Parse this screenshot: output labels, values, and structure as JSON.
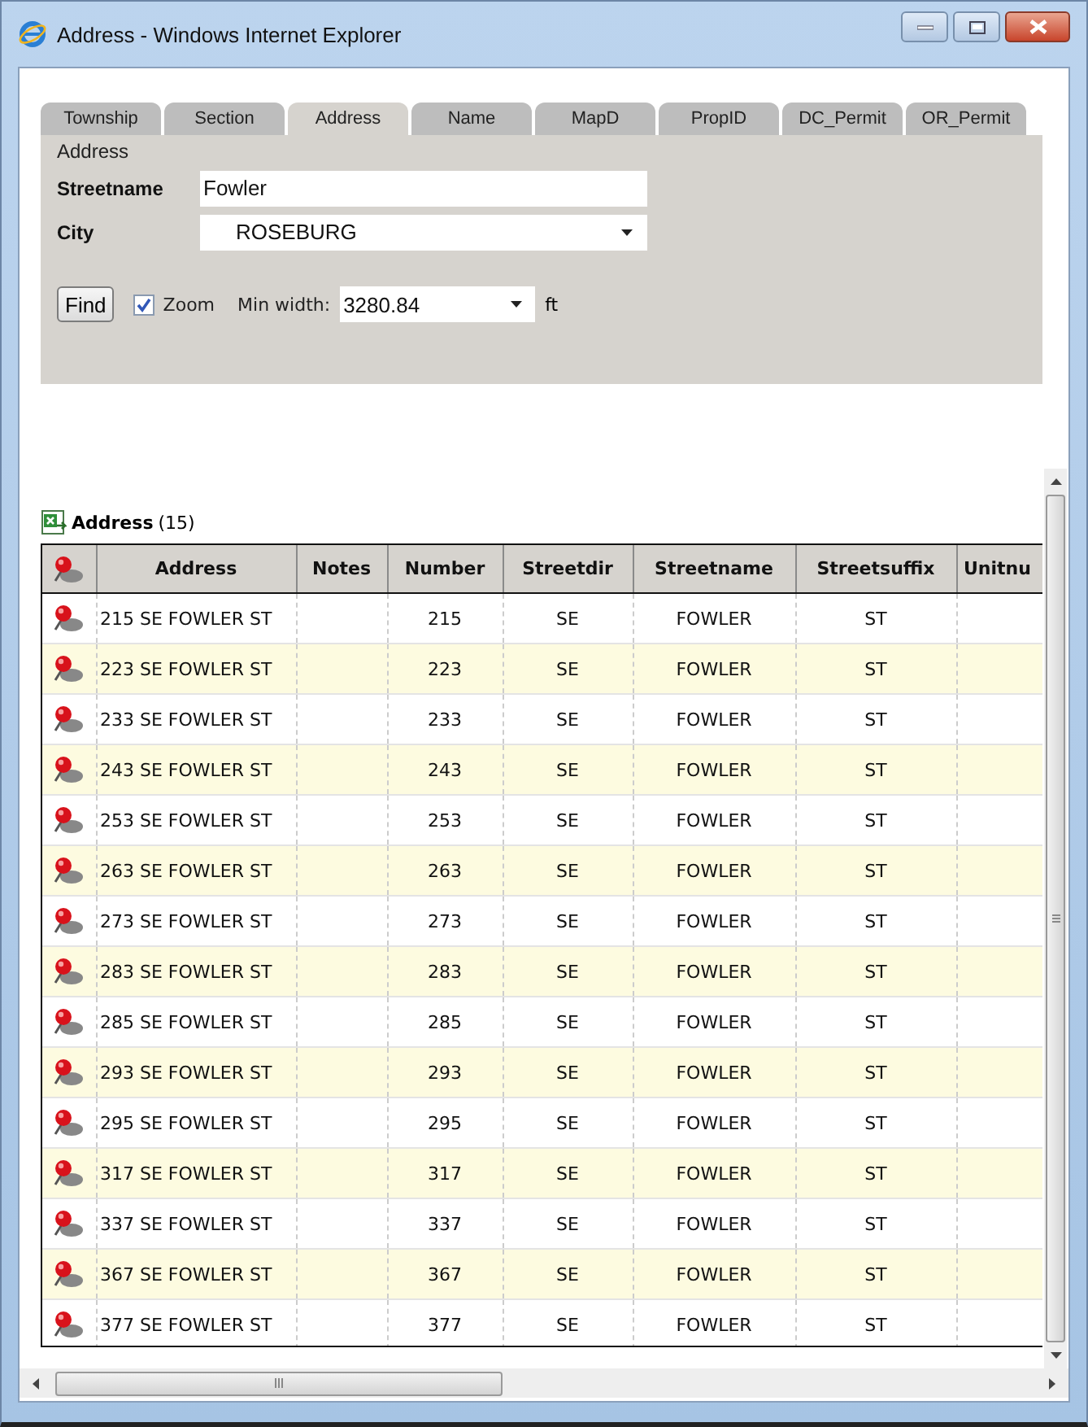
{
  "window": {
    "title": "Address - Windows Internet Explorer"
  },
  "tabs": [
    {
      "label": "Township",
      "selected": false
    },
    {
      "label": "Section",
      "selected": false
    },
    {
      "label": "Address",
      "selected": true
    },
    {
      "label": "Name",
      "selected": false
    },
    {
      "label": "MapD",
      "selected": false
    },
    {
      "label": "PropID",
      "selected": false
    },
    {
      "label": "DC_Permit",
      "selected": false
    },
    {
      "label": "OR_Permit",
      "selected": false
    }
  ],
  "panel": {
    "heading": "Address",
    "fields": [
      {
        "label": "Streetname",
        "kind": "text",
        "value": "Fowler"
      },
      {
        "label": "City",
        "kind": "select",
        "value": "ROSEBURG"
      }
    ],
    "find_button": "Find",
    "zoom": {
      "label": "Zoom",
      "checked": true
    },
    "min_width": {
      "label": "Min width:",
      "value": "3280.84",
      "unit": "ft"
    }
  },
  "results": {
    "title": "Address",
    "count": "(15)",
    "columns": [
      "Address",
      "Notes",
      "Number",
      "Streetdir",
      "Streetname",
      "Streetsuffix",
      "Unitnu"
    ],
    "rows": [
      {
        "address": "215 SE FOWLER ST",
        "number": "215",
        "streetdir": "SE",
        "streetname": "FOWLER",
        "streetsuffix": "ST"
      },
      {
        "address": "223 SE FOWLER ST",
        "number": "223",
        "streetdir": "SE",
        "streetname": "FOWLER",
        "streetsuffix": "ST"
      },
      {
        "address": "233 SE FOWLER ST",
        "number": "233",
        "streetdir": "SE",
        "streetname": "FOWLER",
        "streetsuffix": "ST"
      },
      {
        "address": "243 SE FOWLER ST",
        "number": "243",
        "streetdir": "SE",
        "streetname": "FOWLER",
        "streetsuffix": "ST"
      },
      {
        "address": "253 SE FOWLER ST",
        "number": "253",
        "streetdir": "SE",
        "streetname": "FOWLER",
        "streetsuffix": "ST"
      },
      {
        "address": "263 SE FOWLER ST",
        "number": "263",
        "streetdir": "SE",
        "streetname": "FOWLER",
        "streetsuffix": "ST"
      },
      {
        "address": "273 SE FOWLER ST",
        "number": "273",
        "streetdir": "SE",
        "streetname": "FOWLER",
        "streetsuffix": "ST"
      },
      {
        "address": "283 SE FOWLER ST",
        "number": "283",
        "streetdir": "SE",
        "streetname": "FOWLER",
        "streetsuffix": "ST"
      },
      {
        "address": "285 SE FOWLER ST",
        "number": "285",
        "streetdir": "SE",
        "streetname": "FOWLER",
        "streetsuffix": "ST"
      },
      {
        "address": "293 SE FOWLER ST",
        "number": "293",
        "streetdir": "SE",
        "streetname": "FOWLER",
        "streetsuffix": "ST"
      },
      {
        "address": "295 SE FOWLER ST",
        "number": "295",
        "streetdir": "SE",
        "streetname": "FOWLER",
        "streetsuffix": "ST"
      },
      {
        "address": "317 SE FOWLER ST",
        "number": "317",
        "streetdir": "SE",
        "streetname": "FOWLER",
        "streetsuffix": "ST"
      },
      {
        "address": "337 SE FOWLER ST",
        "number": "337",
        "streetdir": "SE",
        "streetname": "FOWLER",
        "streetsuffix": "ST"
      },
      {
        "address": "367 SE FOWLER ST",
        "number": "367",
        "streetdir": "SE",
        "streetname": "FOWLER",
        "streetsuffix": "ST"
      },
      {
        "address": "377 SE FOWLER ST",
        "number": "377",
        "streetdir": "SE",
        "streetname": "FOWLER",
        "streetsuffix": "ST"
      }
    ]
  }
}
